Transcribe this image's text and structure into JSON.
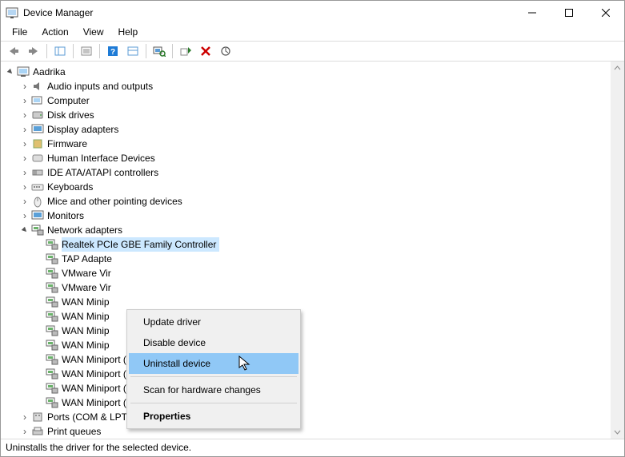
{
  "window": {
    "title": "Device Manager"
  },
  "menus": {
    "file": "File",
    "action": "Action",
    "view": "View",
    "help": "Help"
  },
  "tree": {
    "root": "Aadrika",
    "categories": {
      "c0": "Audio inputs and outputs",
      "c1": "Computer",
      "c2": "Disk drives",
      "c3": "Display adapters",
      "c4": "Firmware",
      "c5": "Human Interface Devices",
      "c6": "IDE ATA/ATAPI controllers",
      "c7": "Keyboards",
      "c8": "Mice and other pointing devices",
      "c9": "Monitors",
      "c10": "Network adapters",
      "c11": "Ports (COM & LPT)",
      "c12": "Print queues"
    },
    "network_adapters": {
      "n0": "Realtek PCIe GBE Family Controller",
      "n1": "TAP Adapte",
      "n2": "VMware Vir",
      "n3": "VMware Vir",
      "n4": "WAN Minip",
      "n5": "WAN Minip",
      "n6": "WAN Minip",
      "n7": "WAN Minip",
      "n8": "WAN Miniport (Network Monitor)",
      "n9": "WAN Miniport (PPPOE)",
      "n10": "WAN Miniport (PPTP)",
      "n11": "WAN Miniport (SSTP)"
    }
  },
  "context_menu": {
    "update": "Update driver",
    "disable": "Disable device",
    "uninstall": "Uninstall device",
    "scan": "Scan for hardware changes",
    "props": "Properties"
  },
  "statusbar": "Uninstalls the driver for the selected device."
}
